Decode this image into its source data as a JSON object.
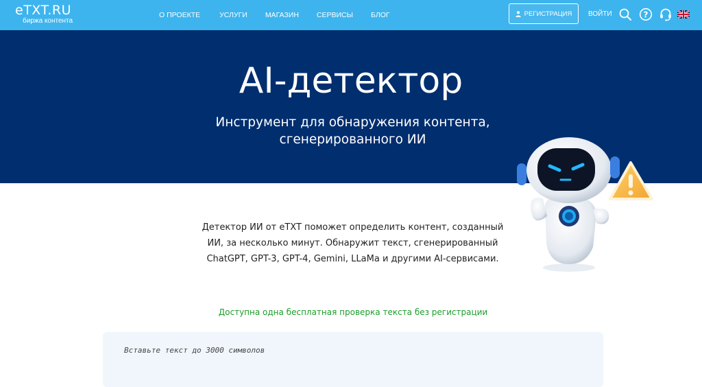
{
  "header": {
    "logo_main": "eTXT.RU",
    "logo_sub": "биржа контента",
    "nav": [
      "О ПРОЕКТЕ",
      "УСЛУГИ",
      "МАГАЗИН",
      "СЕРВИСЫ",
      "БЛОГ"
    ],
    "register_label": "РЕГИСТРАЦИЯ",
    "login_label": "ВОЙТИ",
    "icons": [
      "search-icon",
      "help-icon",
      "support-headset-icon",
      "uk-flag-icon"
    ]
  },
  "hero": {
    "title": "AI-детектор",
    "subtitle": "Инструмент для обнаружения контента, сгенерированного ИИ"
  },
  "content": {
    "description": "Детектор ИИ от eTXT поможет определить контент, созданный ИИ, за несколько минут. Обнаружит текст, сгенерированный ChatGPT, GPT-3, GPT-4, Gemini, LLaMa и другими AI-сервисами.",
    "free_note": "Доступна одна бесплатная проверка текста без регистрации",
    "textarea_placeholder": "Вставьте текст до 3000 символов",
    "textarea_value": ""
  },
  "colors": {
    "header_bg": "#3db4ee",
    "hero_bg": "#002e6e",
    "note_green": "#1c9e2a",
    "textarea_bg": "#f0f6fb"
  }
}
